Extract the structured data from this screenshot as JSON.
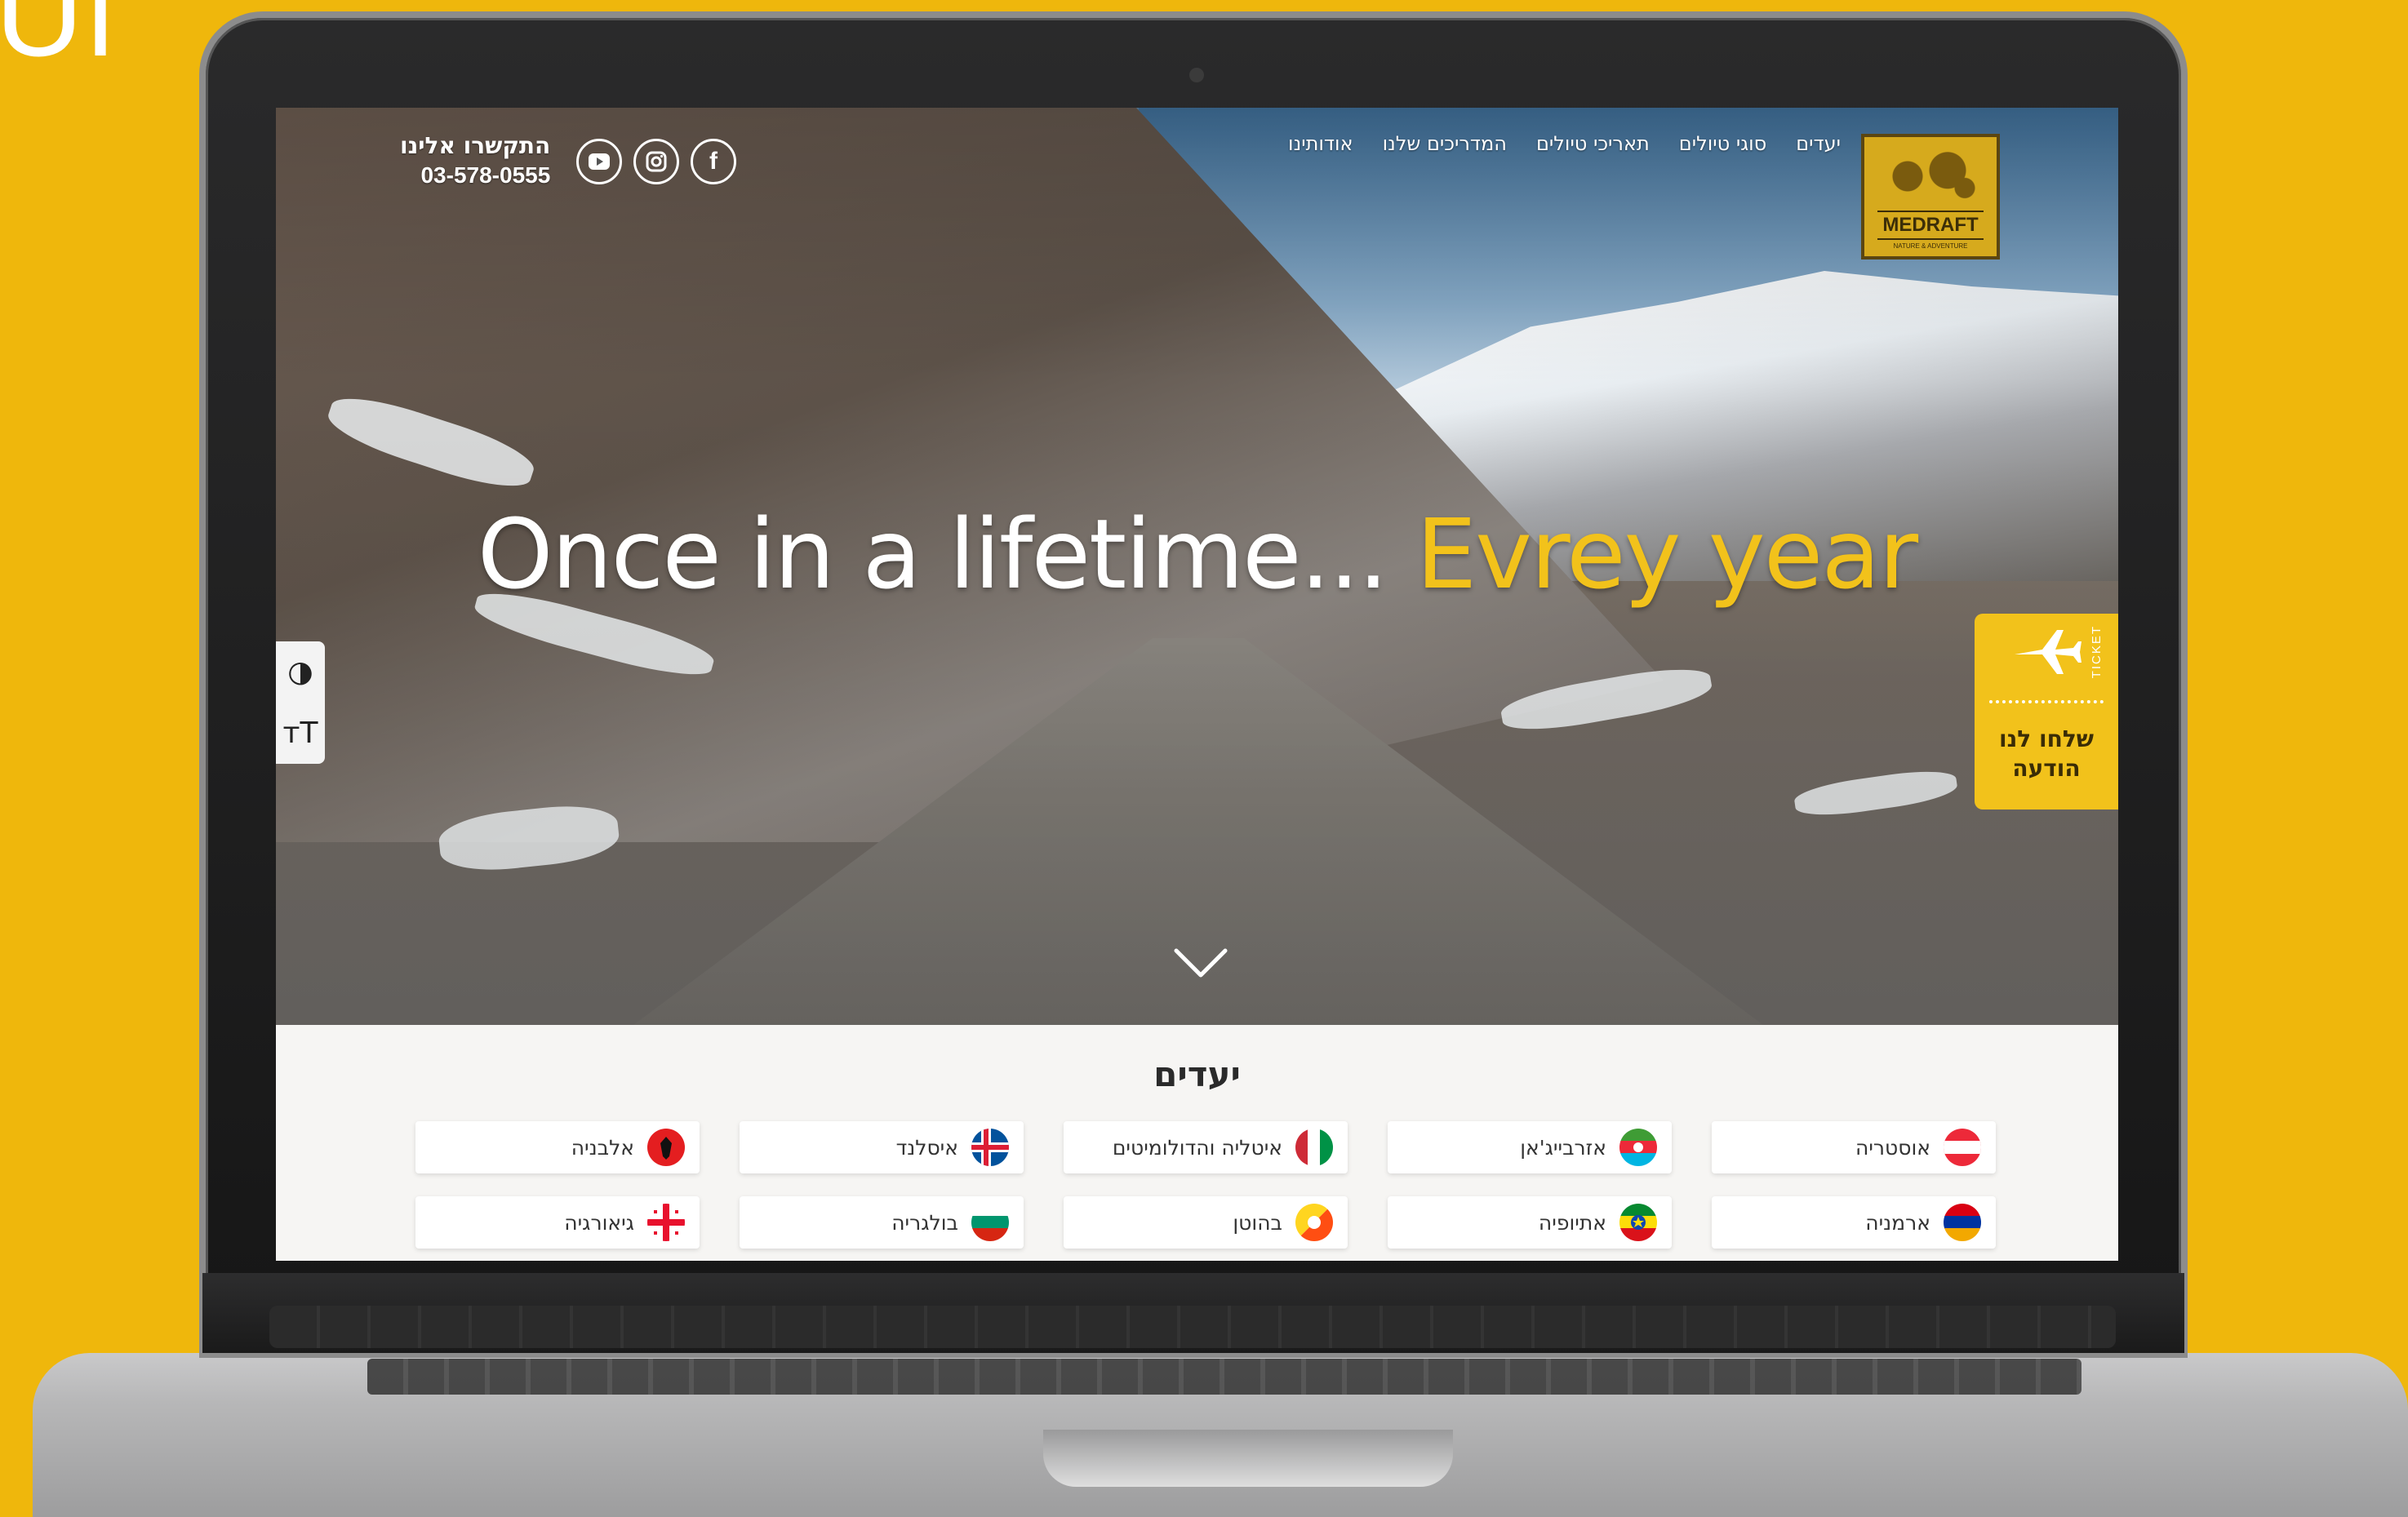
{
  "corner_text": "Ul",
  "header": {
    "nav": [
      "יעדים",
      "סוגי טיולים",
      "תאריכי טיולים",
      "המדריכים שלנו",
      "אודותינו"
    ],
    "contact_title": "התקשרו אלינו",
    "phone": "03-578-0555",
    "logo_name": "MEDRAFT",
    "logo_sub": "NATURE & ADVENTURE",
    "socials": [
      "facebook-icon",
      "instagram-icon",
      "youtube-icon"
    ]
  },
  "hero": {
    "headline_white": "Once in a lifetime... ",
    "headline_yellow": "Evrey year",
    "accent_color": "#f2c21b"
  },
  "ticket": {
    "label": "TICKET",
    "line1": "שלחו לנו",
    "line2": "הודעה"
  },
  "accessibility": {
    "contrast": "◑",
    "text_size": "тT"
  },
  "destinations": {
    "title": "יעדים",
    "items": [
      {
        "name": "אוסטריה",
        "flag": "austria"
      },
      {
        "name": "אזרבייג'אן",
        "flag": "azerbaijan"
      },
      {
        "name": "איטליה והדולומיטים",
        "flag": "italy"
      },
      {
        "name": "איסלנד",
        "flag": "iceland"
      },
      {
        "name": "אלבניה",
        "flag": "albania"
      },
      {
        "name": "ארמניה",
        "flag": "armenia"
      },
      {
        "name": "אתיופיה",
        "flag": "ethiopia"
      },
      {
        "name": "בהוטן",
        "flag": "bhutan"
      },
      {
        "name": "בולגריה",
        "flag": "bulgaria"
      },
      {
        "name": "גיאורגיה",
        "flag": "georgia"
      }
    ]
  }
}
